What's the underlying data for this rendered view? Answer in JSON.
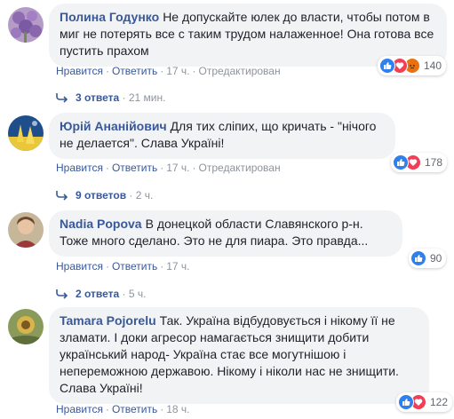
{
  "comments": [
    {
      "author": "Полина Годунко",
      "text": "Не допускайте юлек до власти, чтобы потом в миг не потерять все с таким трудом налаженное! Она готова все пустить прахом",
      "like": "Нравится",
      "reply": "Ответить",
      "time": "17 ч.",
      "edited": "Отредактирован",
      "reactions_count": "140",
      "reactions": [
        "like-icon",
        "love-icon",
        "angry-icon"
      ],
      "replies_label": "3 ответа",
      "replies_time": "21 мин."
    },
    {
      "author": "Юрій Ананійович",
      "text": "Для тих сліпих, що кричать - \"нічого не делается\". Слава Україні!",
      "like": "Нравится",
      "reply": "Ответить",
      "time": "17 ч.",
      "edited": "Отредактирован",
      "reactions_count": "178",
      "reactions": [
        "like-icon",
        "love-icon"
      ],
      "replies_label": "9 ответов",
      "replies_time": "2 ч."
    },
    {
      "author": "Nadia Popova",
      "text": "В донецкой области Славянского р-н. Тоже много сделано. Это не для пиара. Это правда...",
      "like": "Нравится",
      "reply": "Ответить",
      "time": "17 ч.",
      "reactions_count": "90",
      "reactions": [
        "like-icon"
      ],
      "replies_label": "2 ответа",
      "replies_time": "5 ч."
    },
    {
      "author": "Tamara Pojorelu",
      "text": "Так. Україна відбудовується і нікому її не зламати. І доки агресор намагається знищити добити український народ- Україна стає все могутнішою і непереможною державою. Нікому і ніколи нас не знищити. Слава Україні!",
      "like": "Нравится",
      "reply": "Ответить",
      "time": "18 ч.",
      "reactions_count": "122",
      "reactions": [
        "like-icon",
        "love-icon"
      ]
    }
  ],
  "colors": {
    "author": "#385898",
    "bubble": "#f2f3f5",
    "meta": "#8d949e",
    "like": "#2f80ed",
    "love": "#f33e58",
    "angry": "#e9710f"
  }
}
